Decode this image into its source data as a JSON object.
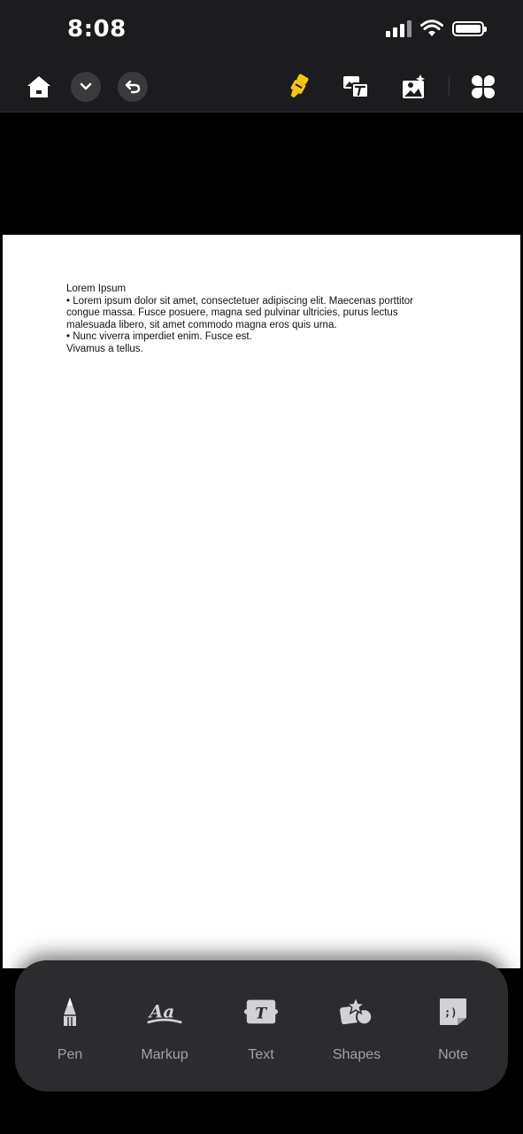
{
  "status_bar": {
    "time": "8:08"
  },
  "toolbar": {
    "home": "home-icon",
    "dropdown": "chevron-down-icon",
    "undo": "undo-icon",
    "highlighter": "highlighter-icon",
    "text_image": "image-text-icon",
    "image_edit": "image-sparkle-icon",
    "apps": "apps-grid-icon",
    "accent_color": "#f5c518"
  },
  "document": {
    "lines": [
      "Lorem Ipsum",
      "• Lorem ipsum dolor sit amet, consectetuer adipiscing elit. Maecenas porttitor",
      "congue massa. Fusce posuere, magna sed pulvinar ultricies, purus lectus",
      "malesuada libero, sit amet commodo magna eros quis urna.",
      "• Nunc viverra imperdiet enim. Fusce est.",
      "Vivamus a tellus."
    ]
  },
  "tools": {
    "pen": "Pen",
    "markup": "Markup",
    "text": "Text",
    "shapes": "Shapes",
    "note": "Note"
  }
}
